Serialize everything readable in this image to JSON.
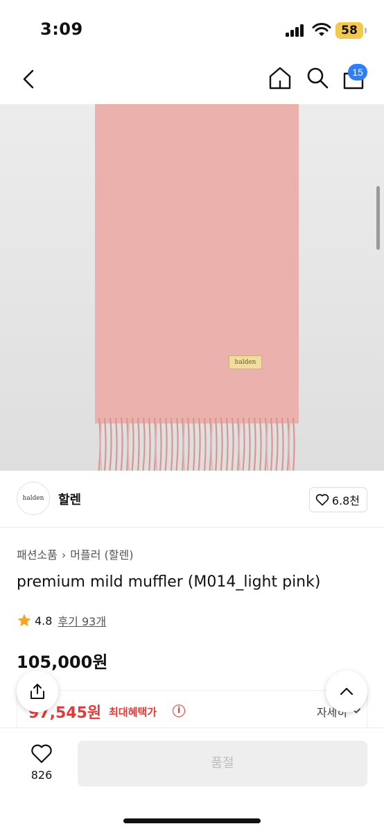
{
  "status_bar": {
    "time": "3:09",
    "battery": "58",
    "battery_color": "#f2c94c"
  },
  "nav": {
    "cart_badge": "15",
    "badge_color": "#2d7ff9"
  },
  "product_image": {
    "scarf_color": "#eab1ad",
    "label_text": "halden"
  },
  "seller": {
    "logo_text": "halden",
    "name": "할렌",
    "likes": "6.8천"
  },
  "breadcrumb": {
    "category": "패션소품",
    "subcategory": "머플러 (할렌)"
  },
  "product": {
    "title": "premium mild muffler (M014_light pink)",
    "rating": "4.8",
    "reviews": "후기 93개",
    "price": "105,000원"
  },
  "benefit": {
    "price": "97,545원",
    "label": "최대혜택가",
    "detail": "자세히",
    "accent_color": "#e53935"
  },
  "bottom_bar": {
    "wish_count": "826",
    "buy_label": "품절"
  }
}
